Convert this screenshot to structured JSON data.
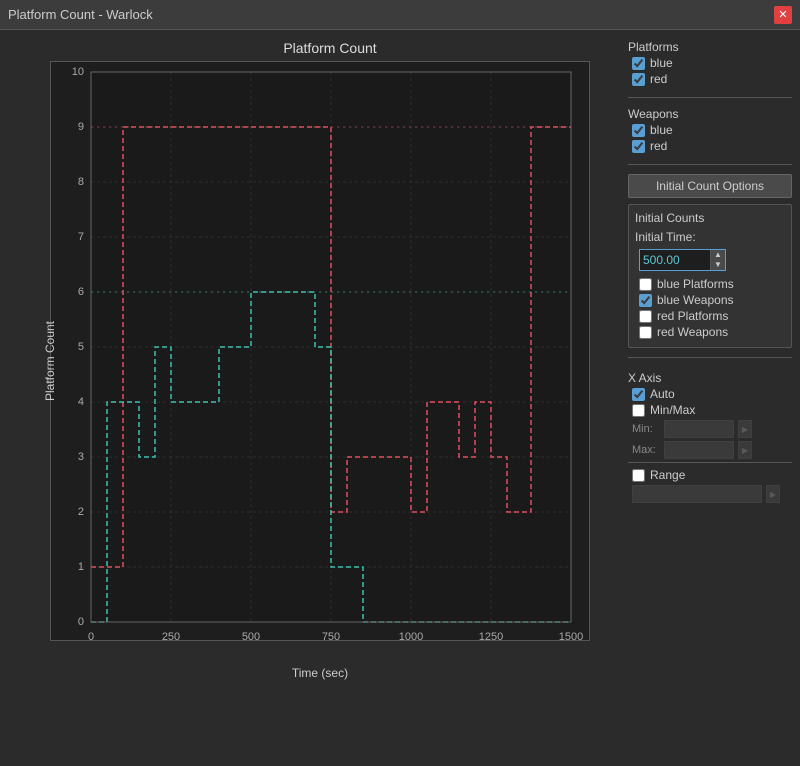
{
  "window": {
    "title": "Platform Count - Warlock"
  },
  "close_button": "✕",
  "chart": {
    "title": "Platform Count",
    "y_label": "Platform Count",
    "x_label": "Time (sec)"
  },
  "sidebar": {
    "platforms_label": "Platforms",
    "blue_platform_label": "blue",
    "red_platform_label": "red",
    "weapons_label": "Weapons",
    "blue_weapon_label": "blue",
    "red_weapon_label": "red",
    "initial_count_btn": "Initial Count Options",
    "initial_counts_label": "Initial Counts",
    "initial_time_label": "Initial Time:",
    "initial_time_value": "500.00",
    "blue_platforms_label": "blue Platforms",
    "blue_weapons_label": "blue Weapons",
    "red_platforms_label": "red Platforms",
    "red_weapons_label": "red Weapons",
    "x_axis_label": "X Axis",
    "auto_label": "Auto",
    "minmax_label": "Min/Max",
    "min_label": "Min:",
    "max_label": "Max:",
    "range_label": "Range"
  },
  "checkboxes": {
    "blue_platform": true,
    "red_platform": true,
    "blue_weapon": true,
    "red_weapon": true,
    "blue_platforms_ic": false,
    "blue_weapons_ic": true,
    "red_platforms_ic": false,
    "red_weapons_ic": false,
    "x_auto": true,
    "x_minmax": false,
    "x_range": false
  }
}
